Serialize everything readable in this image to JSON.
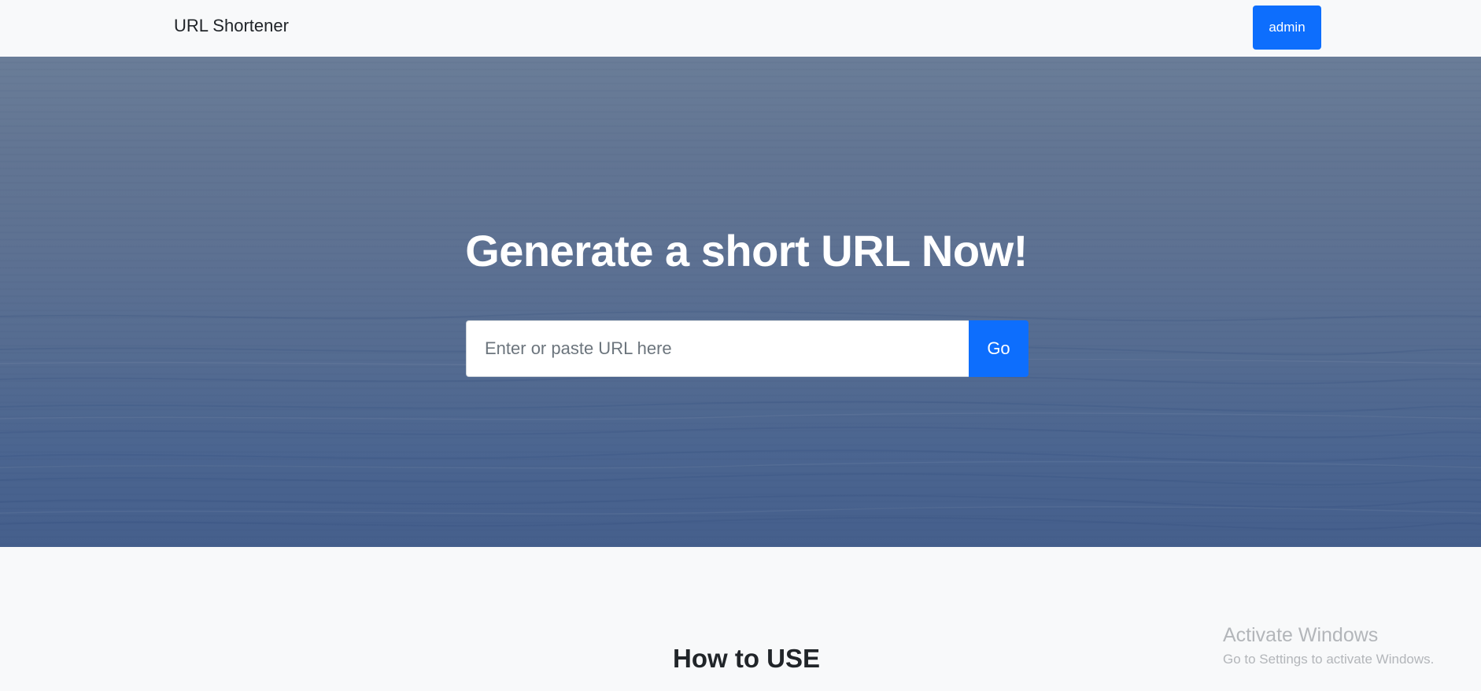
{
  "navbar": {
    "brand": "URL Shortener",
    "admin_label": "admin"
  },
  "hero": {
    "title": "Generate a short URL Now!",
    "input_value": "",
    "input_placeholder": "Enter or paste URL here",
    "go_label": "Go"
  },
  "section": {
    "how_title": "How to USE"
  },
  "watermark": {
    "line1": "Activate Windows",
    "line2": "Go to Settings to activate Windows."
  },
  "colors": {
    "primary": "#0d6efd",
    "page_background": "#f8f9fa",
    "hero_top": "#6a7d98",
    "hero_bottom": "#455f8c"
  }
}
